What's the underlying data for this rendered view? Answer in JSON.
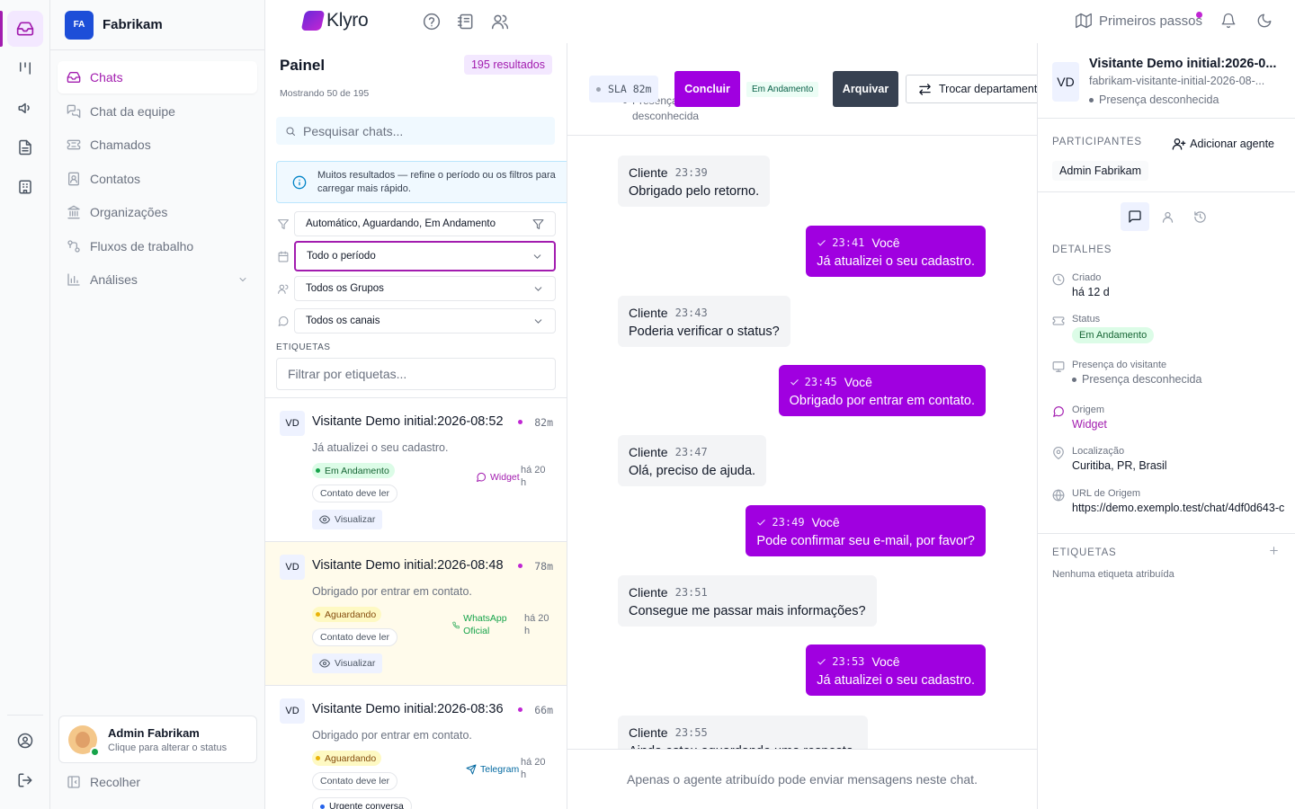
{
  "app": {
    "brand": "Klyro",
    "org_initials": "FA",
    "org_name": "Fabrikam",
    "accent": "#a000e0"
  },
  "topbar": {
    "primeiros": "Primeiros passos"
  },
  "sidebar": {
    "items": [
      {
        "label": "Chats",
        "icon": "inbox-icon"
      },
      {
        "label": "Chat da equipe",
        "icon": "team-chat-icon"
      },
      {
        "label": "Chamados",
        "icon": "ticket-icon"
      },
      {
        "label": "Contatos",
        "icon": "contacts-icon"
      },
      {
        "label": "Organizações",
        "icon": "building-icon"
      },
      {
        "label": "Fluxos de trabalho",
        "icon": "workflow-icon"
      },
      {
        "label": "Análises",
        "icon": "chart-icon"
      }
    ],
    "user_name": "Admin Fabrikam",
    "user_status_hint": "Clique para alterar o status",
    "collapse": "Recolher"
  },
  "list": {
    "title": "Painel",
    "results": "195 resultados",
    "showing": "Mostrando 50 de 195",
    "search_placeholder": "Pesquisar chats...",
    "info": "Muitos resultados — refine o período ou os filtros para carregar mais rápido.",
    "filter_status": "Automático, Aguardando, Em Andamento",
    "filter_period": "Todo o período",
    "filter_groups": "Todos os Grupos",
    "filter_channels": "Todos os canais",
    "tags_label": "ETIQUETAS",
    "tags_placeholder": "Filtrar por etiquetas...",
    "chats": [
      {
        "initials": "VD",
        "name": "Visitante Demo initial:2026-08:52",
        "age": "82m",
        "message": "Já atualizei o seu cadastro.",
        "status": "Em Andamento",
        "contact": "Contato deve ler",
        "channel": "Widget",
        "time": "há 20 h",
        "view": "Visualizar"
      },
      {
        "initials": "VD",
        "name": "Visitante Demo initial:2026-08:48",
        "age": "78m",
        "message": "Obrigado por entrar em contato.",
        "status": "Aguardando",
        "contact": "Contato deve ler",
        "channel": "WhatsApp Oficial",
        "time": "há 20 h",
        "view": "Visualizar"
      },
      {
        "initials": "VD",
        "name": "Visitante Demo initial:2026-08:36",
        "age": "66m",
        "message": "Obrigado por entrar em contato.",
        "status": "Aguardando",
        "contact": "Contato deve ler",
        "channel": "Telegram",
        "time": "há 20 h",
        "urgent": "Urgente conversa"
      }
    ]
  },
  "conversation": {
    "sla": "SLA 82m",
    "presence_behind": "Presença desconhecida",
    "conclude": "Concluir",
    "status_badge": "Em Andamento",
    "archive": "Arquivar",
    "transfer": "Trocar departamento",
    "messages": [
      {
        "dir": "in",
        "sender": "Cliente",
        "time": "23:39",
        "text": "Obrigado pelo retorno."
      },
      {
        "dir": "out",
        "sender": "Você",
        "time": "23:41",
        "text": "Já atualizei o seu cadastro."
      },
      {
        "dir": "in",
        "sender": "Cliente",
        "time": "23:43",
        "text": "Poderia verificar o status?"
      },
      {
        "dir": "out",
        "sender": "Você",
        "time": "23:45",
        "text": "Obrigado por entrar em contato."
      },
      {
        "dir": "in",
        "sender": "Cliente",
        "time": "23:47",
        "text": "Olá, preciso de ajuda."
      },
      {
        "dir": "out",
        "sender": "Você",
        "time": "23:49",
        "text": "Pode confirmar seu e-mail, por favor?"
      },
      {
        "dir": "in",
        "sender": "Cliente",
        "time": "23:51",
        "text": "Consegue me passar mais informações?"
      },
      {
        "dir": "out",
        "sender": "Você",
        "time": "23:53",
        "text": "Já atualizei o seu cadastro."
      },
      {
        "dir": "in",
        "sender": "Cliente",
        "time": "23:55",
        "text": "Ainda estou aguardando uma resposta."
      }
    ],
    "footer": "Apenas o agente atribuído pode enviar mensagens neste chat."
  },
  "details": {
    "initials": "VD",
    "name": "Visitante Demo initial:2026-0...",
    "slug": "fabrikam-visitante-initial-2026-08-...",
    "presence": "Presença desconhecida",
    "participants_label": "PARTICIPANTES",
    "add_agent": "Adicionar agente",
    "participant": "Admin Fabrikam",
    "details_label": "DETALHES",
    "created_label": "Criado",
    "created_value": "há 12 d",
    "status_label": "Status",
    "status_value": "Em Andamento",
    "visitor_presence_label": "Presença do visitante",
    "visitor_presence_value": "Presença desconhecida",
    "origin_label": "Origem",
    "origin_value": "Widget",
    "location_label": "Localização",
    "location_value": "Curitiba, PR, Brasil",
    "url_label": "URL de Origem",
    "url_value": "https://demo.exemplo.test/chat/4df0d643-c",
    "tags_label": "ETIQUETAS",
    "no_tags": "Nenhuma etiqueta atribuída"
  }
}
